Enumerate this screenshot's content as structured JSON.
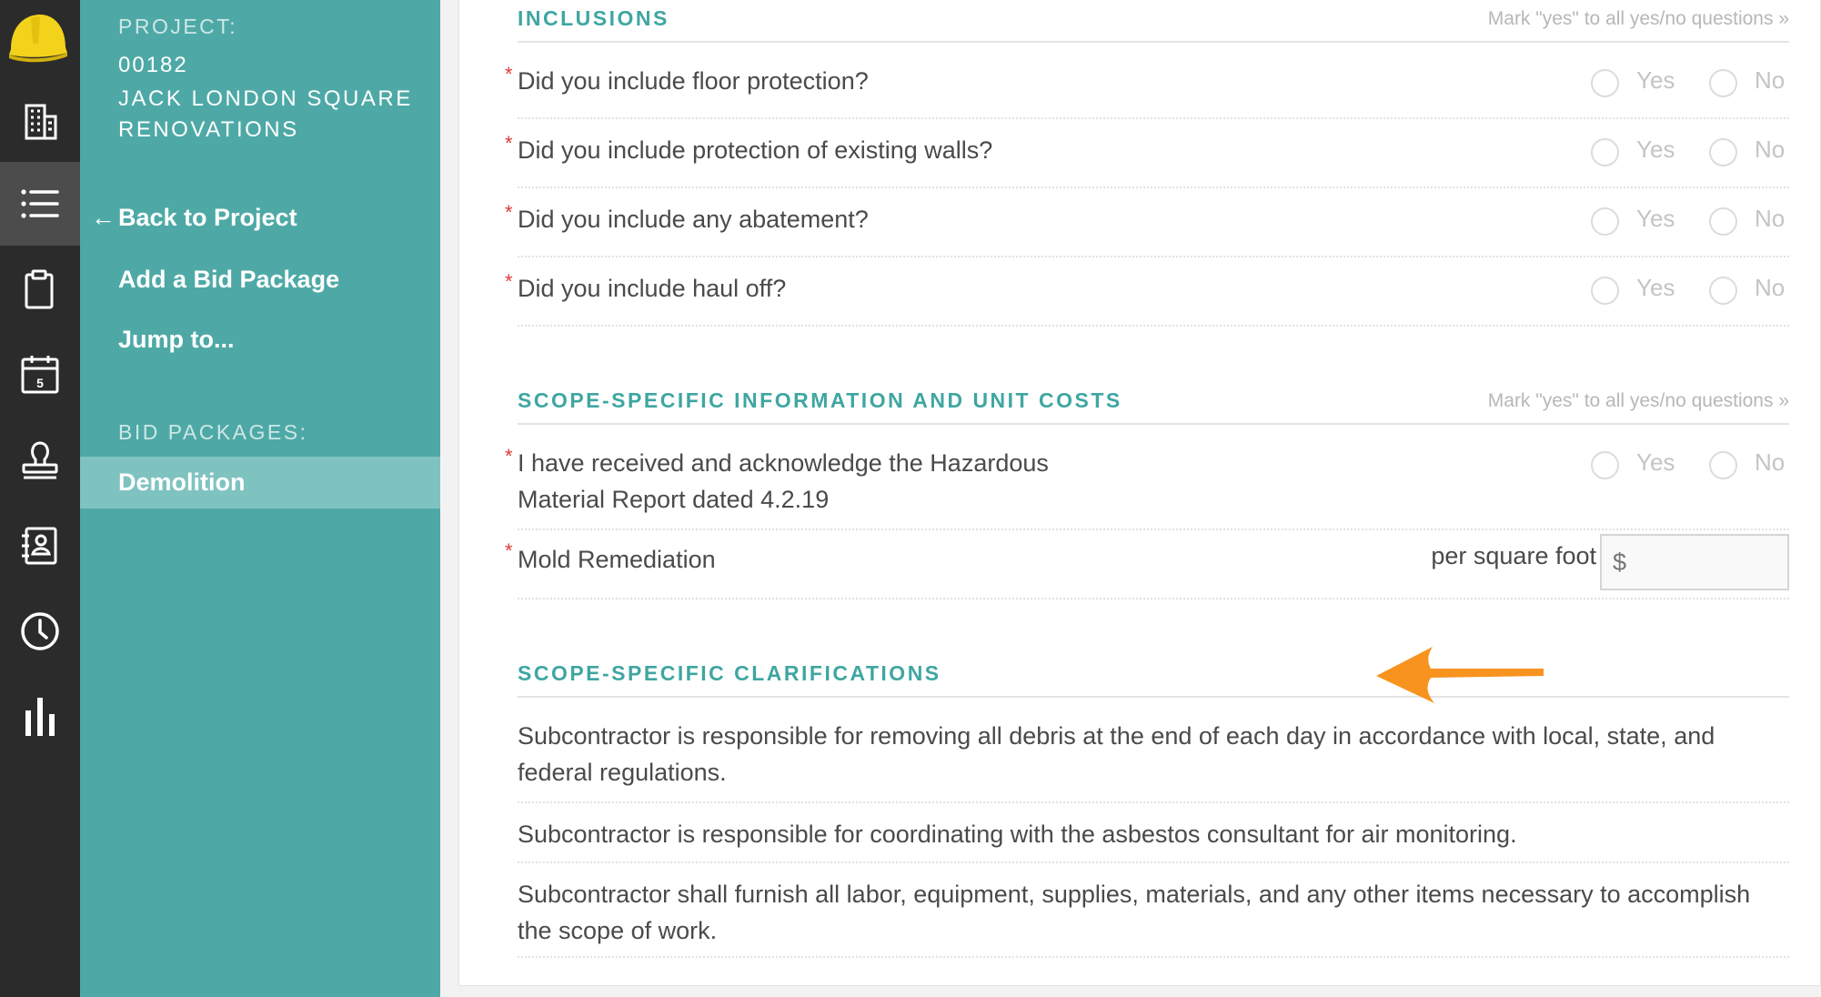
{
  "rail": {
    "icons": [
      "hard-hat-logo",
      "building-icon",
      "list-icon",
      "clipboard-icon",
      "calendar-icon",
      "stamp-icon",
      "contacts-icon",
      "clock-icon",
      "bar-chart-icon"
    ],
    "calendar_day": "5",
    "active": "list-icon"
  },
  "sidebar": {
    "project_label": "PROJECT:",
    "project_number": "00182",
    "project_name": "JACK LONDON SQUARE RENOVATIONS",
    "back_arrow": "←",
    "back_label": "Back to Project",
    "add_bid_package": "Add a Bid Package",
    "jump_to": "Jump to...",
    "bid_packages_label": "BID PACKAGES:",
    "bid_packages": [
      "Demolition"
    ]
  },
  "form": {
    "inclusions": {
      "title": "INCLUSIONS",
      "mark_all": "Mark \"yes\" to all yes/no questions »",
      "questions": [
        "Did you include floor protection?",
        "Did you include protection of existing walls?",
        "Did you include any abatement?",
        "Did you include haul off?"
      ]
    },
    "scope_info": {
      "title": "SCOPE-SPECIFIC INFORMATION AND UNIT COSTS",
      "mark_all": "Mark \"yes\" to all yes/no questions »",
      "hazardous_line1": "I have received and acknowledge the Hazardous",
      "hazardous_line2": "Material Report dated 4.2.19",
      "mold_label": "Mold Remediation",
      "unit_label": "per square foot",
      "unit_placeholder": "$"
    },
    "clarifications": {
      "title": "SCOPE-SPECIFIC CLARIFICATIONS",
      "items": [
        "Subcontractor is responsible for removing all debris at the end of each day in accordance with local, state, and federal regulations.",
        "Subcontractor is responsible for coordinating with the asbestos consultant for air monitoring.",
        "Subcontractor shall furnish all labor, equipment, supplies, materials, and any other items necessary to accomplish the scope of work."
      ]
    },
    "required_mark": "*",
    "yes_label": "Yes",
    "no_label": "No"
  },
  "colors": {
    "rail_bg": "#2b2b2b",
    "sidebar_bg": "#4ea9a6",
    "selected_bid_package_bg": "#7fc3c0",
    "section_title": "#3fa6a1",
    "required": "#e03a3a",
    "annotation_arrow": "#f7931e"
  }
}
